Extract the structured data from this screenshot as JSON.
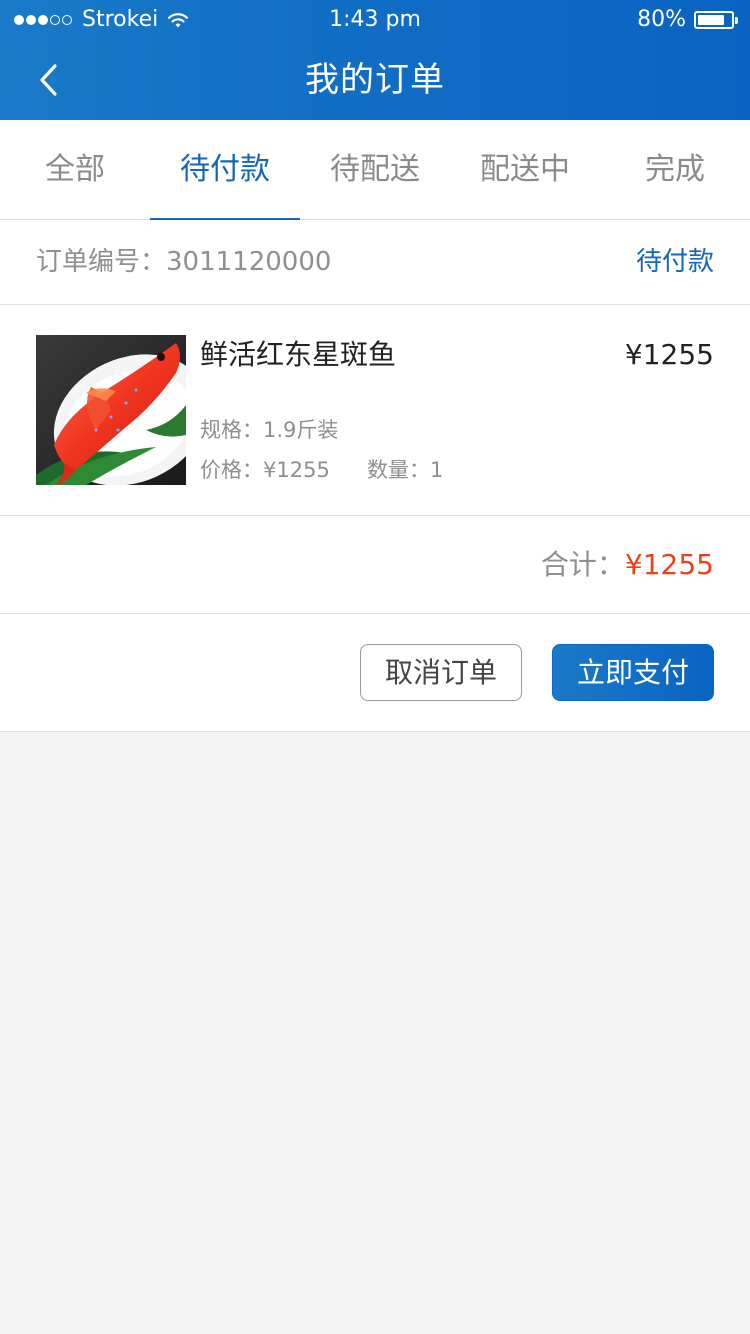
{
  "status_bar": {
    "carrier": "Strokei",
    "time": "1:43 pm",
    "battery_text": "80%",
    "battery_level": 0.8,
    "signal_filled": 3,
    "signal_total": 5
  },
  "nav": {
    "title": "我的订单",
    "back_icon": "chevron-left-icon"
  },
  "tabs": [
    {
      "label": "全部",
      "active": false
    },
    {
      "label": "待付款",
      "active": true
    },
    {
      "label": "待配送",
      "active": false
    },
    {
      "label": "配送中",
      "active": false
    },
    {
      "label": "完成",
      "active": false
    }
  ],
  "order": {
    "number_label": "订单编号：3011120000",
    "status": "待付款",
    "product": {
      "name": "鲜活红东星斑鱼",
      "price": "¥1255",
      "spec": "规格：1.9斤装",
      "unit_price": "价格：¥1255",
      "quantity": "数量：1"
    },
    "total_label": "合计：",
    "total_value": "¥1255",
    "cancel_label": "取消订单",
    "pay_label": "立即支付"
  },
  "colors": {
    "brand_blue": "#1366b8",
    "price_red": "#e8421e",
    "page_bg": "#f3f3f3"
  }
}
